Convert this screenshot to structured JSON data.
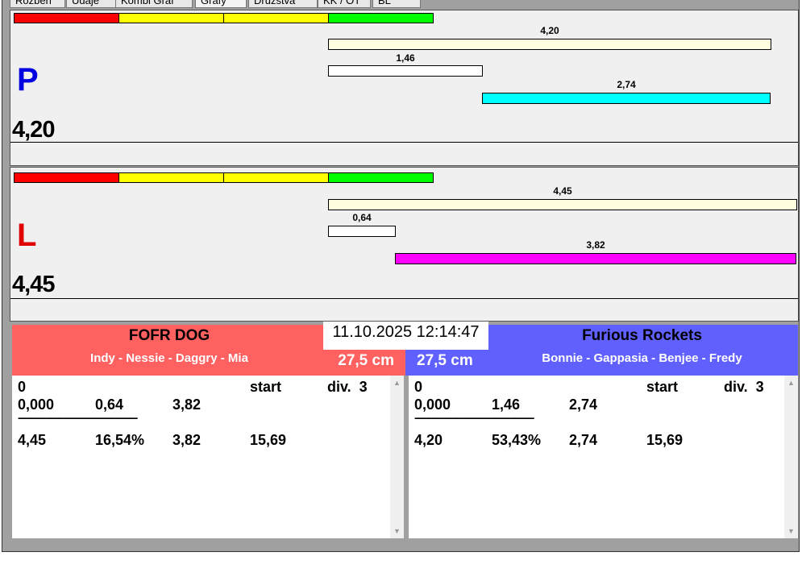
{
  "tabs": [
    "Rozběh",
    "Údaje",
    "Kombi Graf",
    "Grafy",
    "Družstva",
    "KK / OT",
    "BL"
  ],
  "colors": {
    "red": "#ff0000",
    "yellow": "#ffff00",
    "green": "#00ff00",
    "cream": "#ffffe0",
    "cyan": "#00ffff",
    "magenta": "#ff00ff",
    "team_left": "#ff6060",
    "team_right": "#6060ff"
  },
  "right_lane": {
    "label": "P",
    "total": "4,20",
    "bar_total": "4,20",
    "bar_reaction": "1,46",
    "bar_run": "2,74"
  },
  "left_lane": {
    "label": "L",
    "total": "4,45",
    "bar_total": "4,45",
    "bar_reaction": "0,64",
    "bar_run": "3,82"
  },
  "datetime": "11.10.2025 12:14:47",
  "team_left": {
    "name": "FOFR DOG",
    "dogs": "Indy - Nessie - Daggry - Mia",
    "height": "27,5 cm",
    "header": [
      "0",
      "start",
      "div.  3"
    ],
    "row1": [
      "0,000",
      "0,64",
      "3,82"
    ],
    "separator": "--------------------------------------------",
    "row2": [
      "4,45",
      "16,54%",
      "3,82",
      "15,69"
    ]
  },
  "team_right": {
    "name": "Furious Rockets",
    "dogs": "Bonnie - Gappasia - Benjee - Fredy",
    "height": "27,5 cm",
    "header": [
      "0",
      "start",
      "div.  3"
    ],
    "row1": [
      "0,000",
      "1,46",
      "2,74"
    ],
    "separator": "--------------------------------------------",
    "row2": [
      "4,20",
      "53,43%",
      "2,74",
      "15,69"
    ]
  }
}
